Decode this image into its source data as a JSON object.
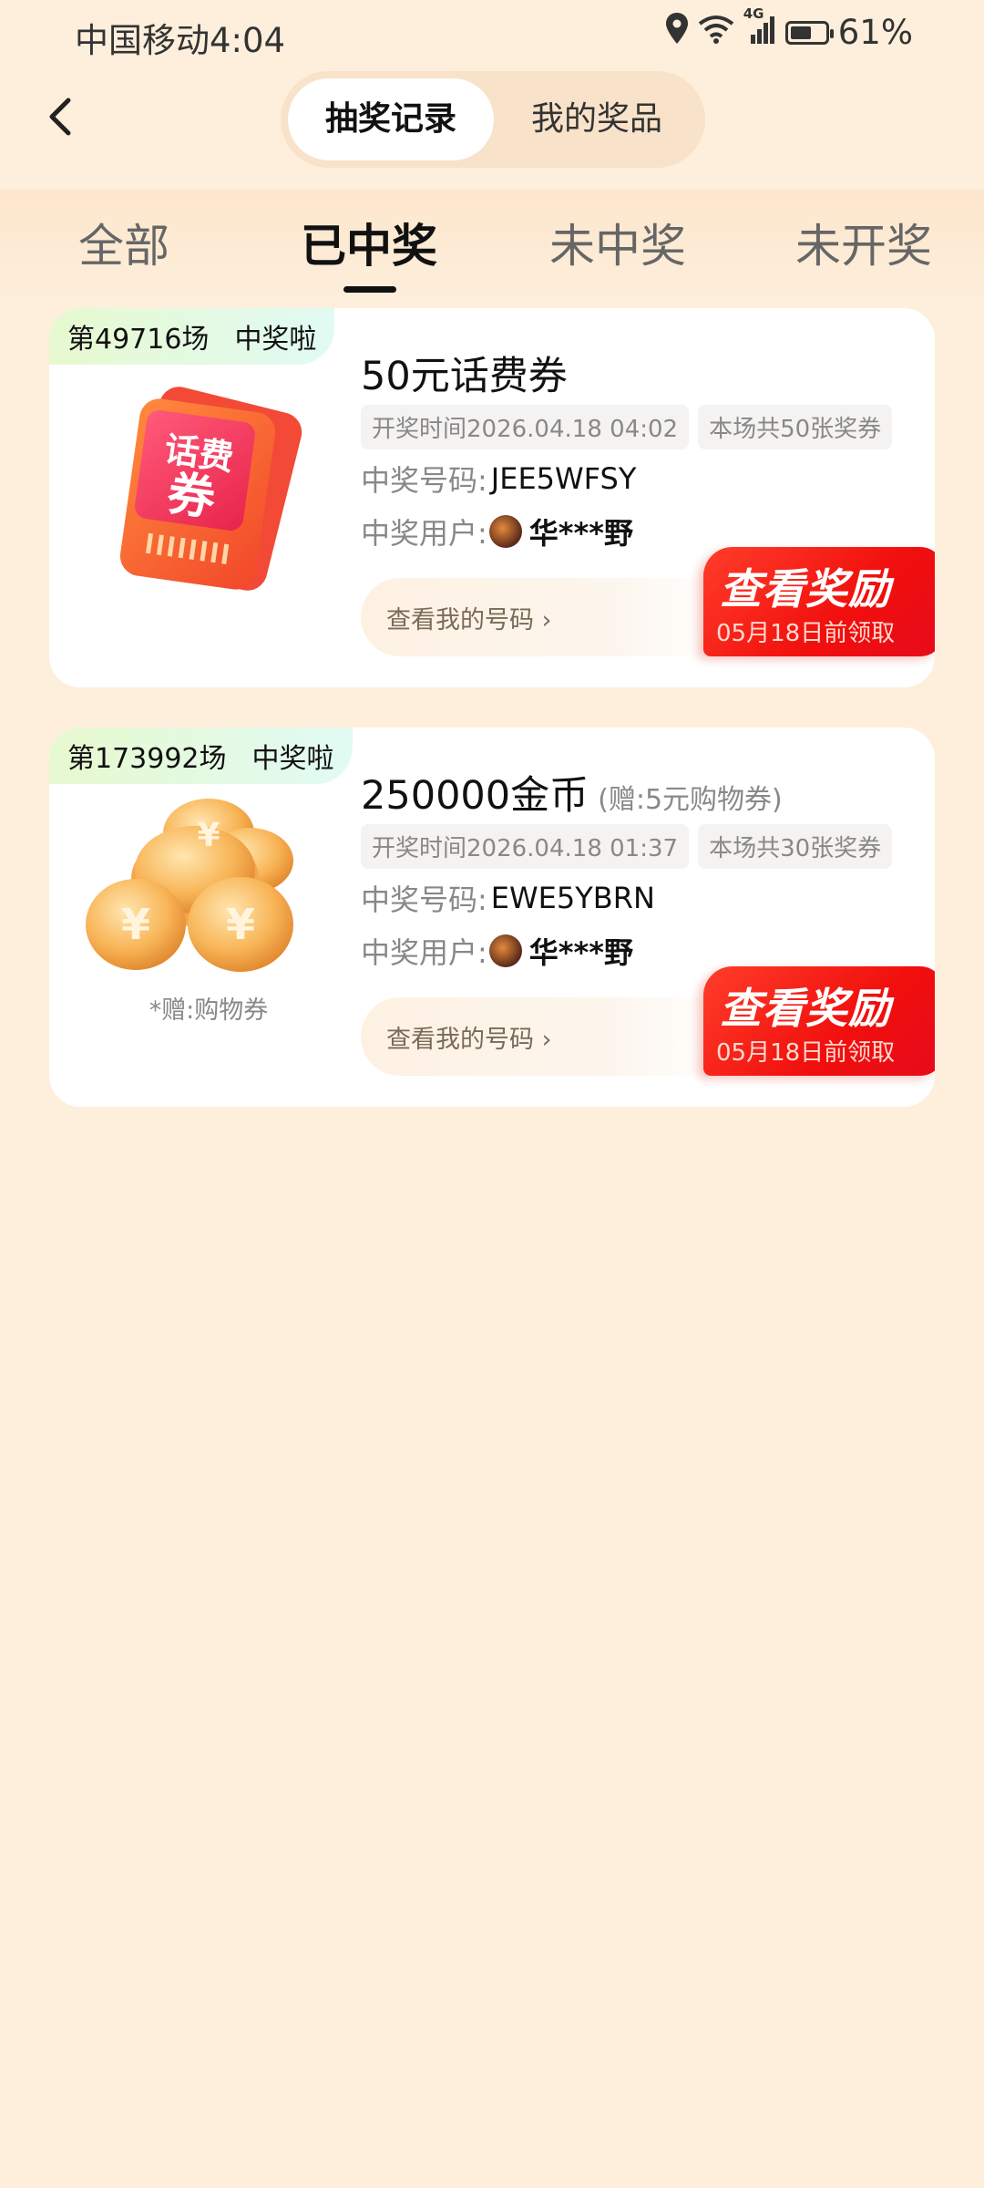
{
  "status_bar": {
    "carrier_time": "中国移动4:04",
    "network": "4G",
    "battery_percent": "61%",
    "battery_level": 0.61,
    "icons": [
      "location-icon",
      "wifi-icon",
      "signal-icon",
      "battery-icon"
    ]
  },
  "header": {
    "back_icon": "chevron-left-icon",
    "segments": [
      "抽奖记录",
      "我的奖品"
    ],
    "active_segment": "抽奖记录"
  },
  "tabs": {
    "items": [
      "全部",
      "已中奖",
      "未中奖",
      "未开奖"
    ],
    "active": "已中奖"
  },
  "records": [
    {
      "round": "第49716场",
      "status": "中奖啦",
      "image_icon": "phone-bill-coupon-icon",
      "image_text": [
        "话费",
        "券"
      ],
      "prize": "50元话费券",
      "prize_extra": "",
      "image_note": "",
      "draw_time": "开奖时间2026.04.18 04:02",
      "coupon_count": "本场共50张奖券",
      "win_code_label": "中奖号码:",
      "win_code": "JEE5WFSY",
      "winner_label": "中奖用户:",
      "winner": "华***野",
      "my_numbers_link": "查看我的号码 ›",
      "reward_button": "查看奖励",
      "deadline": "05月18日前领取"
    },
    {
      "round": "第173992场",
      "status": "中奖啦",
      "image_icon": "gold-coins-icon",
      "image_text": [],
      "prize": "250000金币",
      "prize_extra": "(赠:5元购物券)",
      "image_note": "*赠:购物券",
      "draw_time": "开奖时间2026.04.18 01:37",
      "coupon_count": "本场共30张奖券",
      "win_code_label": "中奖号码:",
      "win_code": "EWE5YBRN",
      "winner_label": "中奖用户:",
      "winner": "华***野",
      "my_numbers_link": "查看我的号码 ›",
      "reward_button": "查看奖励",
      "deadline": "05月18日前领取"
    }
  ]
}
